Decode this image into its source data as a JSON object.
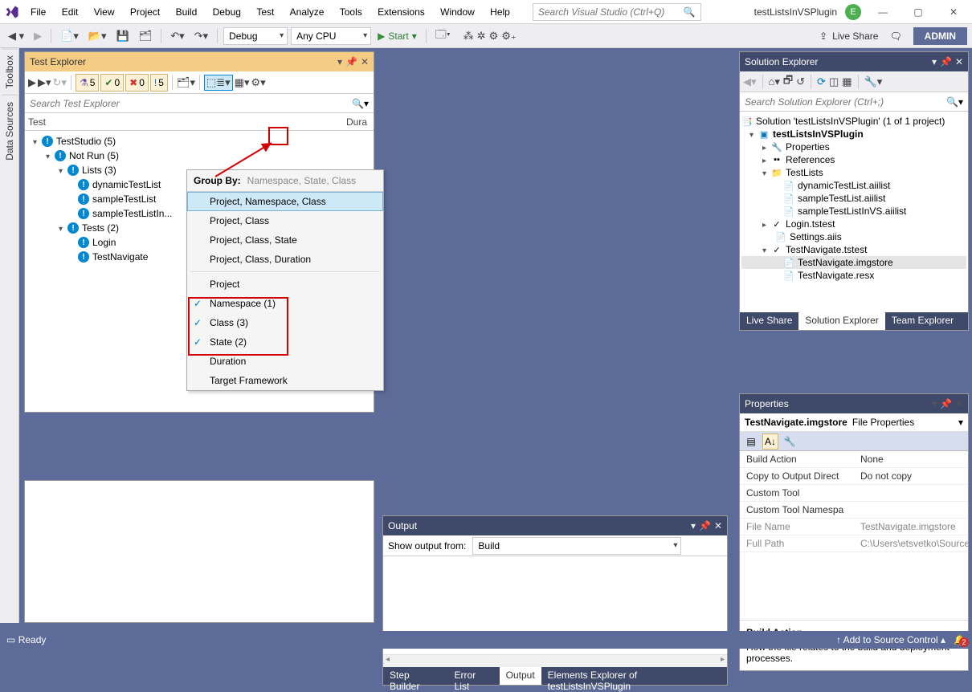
{
  "title_project": "testListsInVSPlugin",
  "avatar_letter": "E",
  "menubar": [
    "File",
    "Edit",
    "View",
    "Project",
    "Build",
    "Debug",
    "Test",
    "Analyze",
    "Tools",
    "Extensions",
    "Window",
    "Help"
  ],
  "global_search_placeholder": "Search Visual Studio (Ctrl+Q)",
  "toolbar": {
    "config": "Debug",
    "platform": "Any CPU",
    "start": "Start",
    "live_share": "Live Share",
    "admin": "ADMIN"
  },
  "side_tabs": [
    "Toolbox",
    "Data Sources"
  ],
  "test_explorer": {
    "title": "Test Explorer",
    "search_placeholder": "Search Test Explorer",
    "counts": {
      "flask": "5",
      "pass": "0",
      "fail": "0",
      "info": "5"
    },
    "cols": {
      "test": "Test",
      "dura": "Dura"
    },
    "tree": {
      "root": "TestStudio  (5)",
      "notrun": "Not Run  (5)",
      "lists": "Lists  (3)",
      "l1": "dynamicTestList",
      "l2": "sampleTestList",
      "l3": "sampleTestListIn...",
      "tests": "Tests  (2)",
      "t1": "Login",
      "t2": "TestNavigate"
    }
  },
  "popup": {
    "label": "Group By:",
    "current": "Namespace, State, Class",
    "items": [
      "Project, Namespace, Class",
      "Project, Class",
      "Project, Class, State",
      "Project, Class, Duration"
    ],
    "single": "Project",
    "checked": [
      "Namespace (1)",
      "Class (3)",
      "State (2)"
    ],
    "extra": [
      "Duration",
      "Target Framework"
    ]
  },
  "output": {
    "title": "Output",
    "show_label": "Show output from:",
    "source": "Build",
    "tabs": [
      "Step Builder",
      "Error List",
      "Output",
      "Elements Explorer of testListsInVSPlugin"
    ]
  },
  "solution_explorer": {
    "title": "Solution Explorer",
    "search_placeholder": "Search Solution Explorer (Ctrl+;)",
    "sol": "Solution 'testListsInVSPlugin' (1 of 1 project)",
    "proj": "testListsInVSPlugin",
    "properties": "Properties",
    "references": "References",
    "testlists": "TestLists",
    "tl1": "dynamicTestList.aiilist",
    "tl2": "sampleTestList.aiilist",
    "tl3": "sampleTestListInVS.aiilist",
    "login": "Login.tstest",
    "settings": "Settings.aiis",
    "tn": "TestNavigate.tstest",
    "tn1": "TestNavigate.imgstore",
    "tn2": "TestNavigate.resx",
    "tabs": [
      "Live Share",
      "Solution Explorer",
      "Team Explorer"
    ]
  },
  "properties": {
    "title": "Properties",
    "obj_name": "TestNavigate.imgstore",
    "obj_type": "File Properties",
    "rows": [
      {
        "k": "Build Action",
        "v": "None"
      },
      {
        "k": "Copy to Output Direct",
        "v": "Do not copy"
      },
      {
        "k": "Custom Tool",
        "v": ""
      },
      {
        "k": "Custom Tool Namespa",
        "v": ""
      }
    ],
    "dimrows": [
      {
        "k": "File Name",
        "v": "TestNavigate.imgstore"
      },
      {
        "k": "Full Path",
        "v": "C:\\Users\\etsvetko\\Source\\R"
      }
    ],
    "desc_title": "Build Action",
    "desc_body": "How the file relates to the build and deployment processes."
  },
  "status": {
    "ready": "Ready",
    "source_control": "Add to Source Control",
    "notif_count": "2"
  }
}
